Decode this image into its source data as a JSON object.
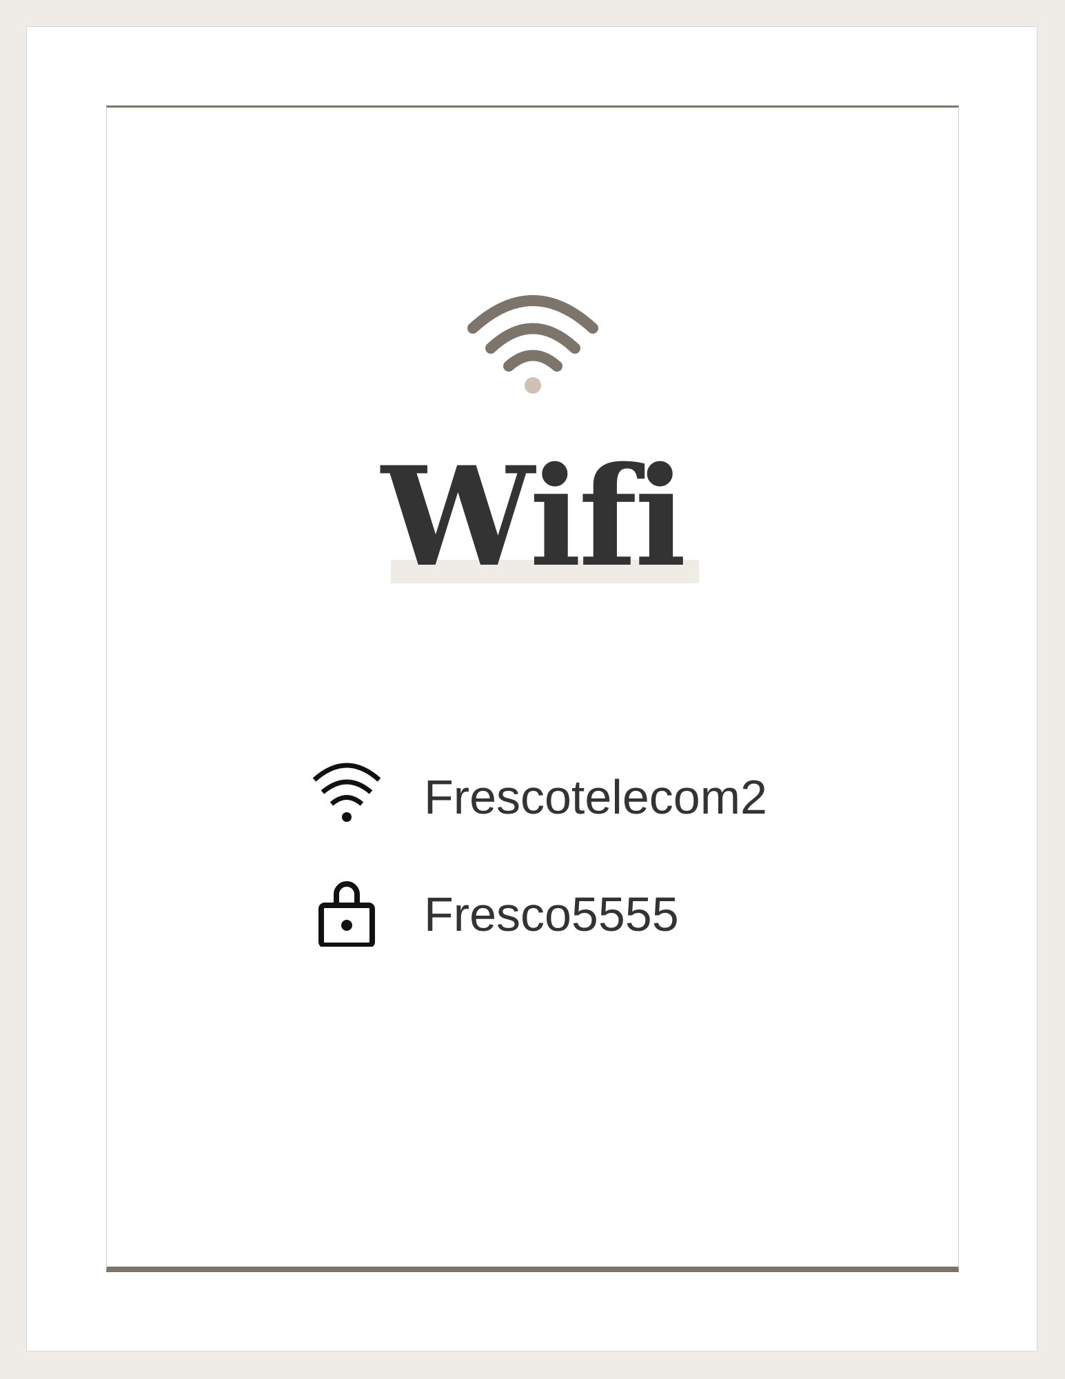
{
  "title": "Wifi",
  "network": {
    "icon": "wifi-icon",
    "name": "Frescotelecom2"
  },
  "password": {
    "icon": "lock-icon",
    "value": "Fresco5555"
  },
  "colors": {
    "background": "#efece7",
    "accent": "#7d746b",
    "dot": "#cfc1b5",
    "text": "#333333"
  }
}
